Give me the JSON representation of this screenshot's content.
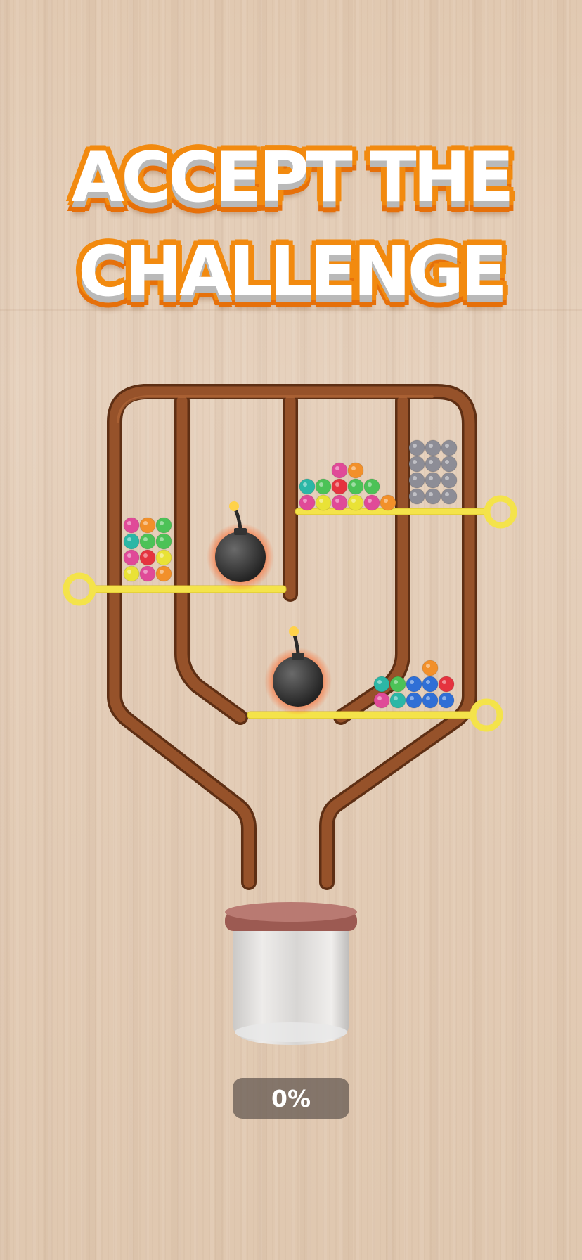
{
  "headline": {
    "line1": "ACCEPT THE",
    "line2": "CHALLENGE"
  },
  "progress": {
    "label": "0%",
    "value": 0
  },
  "colors": {
    "pipe": "#8a4a22",
    "pin": "#f4e34a",
    "title_outline": "#f28a0f",
    "jar_lid": "#b06a62"
  },
  "icons": [
    "bomb-icon",
    "pull-ring-icon",
    "jar-icon"
  ]
}
